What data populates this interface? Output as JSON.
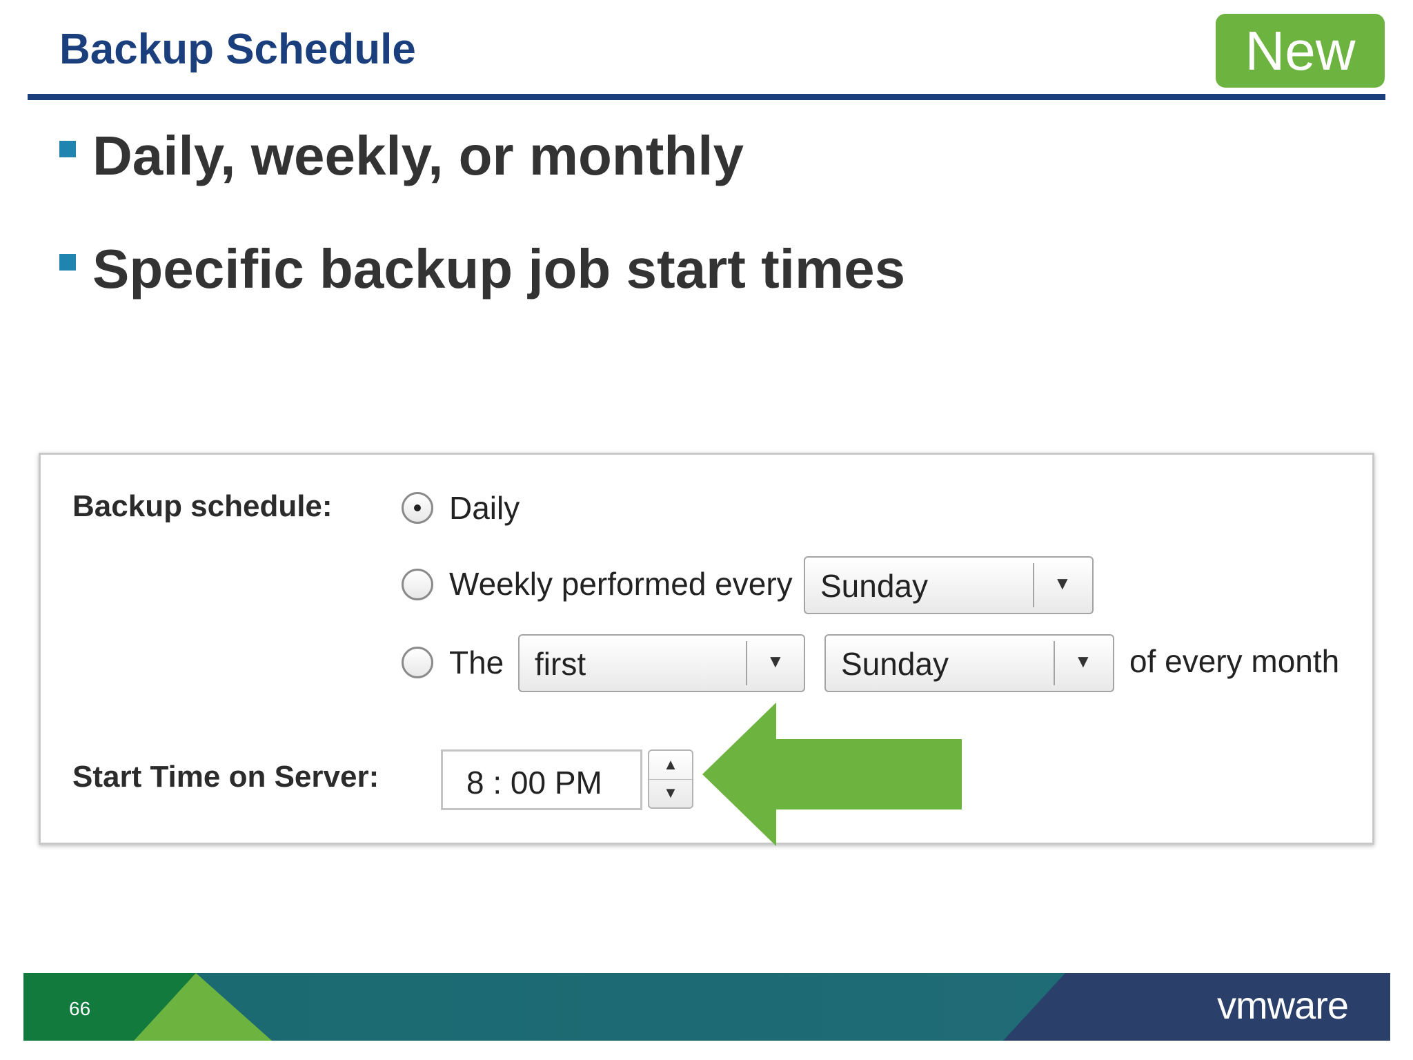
{
  "slide": {
    "title": "Backup Schedule",
    "badge": "New",
    "bullets": [
      "Daily, weekly, or monthly",
      "Specific backup job start times"
    ],
    "page_number": "66",
    "logo_text": "vmware"
  },
  "form": {
    "schedule_label": "Backup schedule:",
    "options": {
      "daily": "Daily",
      "weekly": "Weekly performed every",
      "monthly_prefix": "The",
      "monthly_suffix": "of every month"
    },
    "selected_option": "daily",
    "weekly_day": "Sunday",
    "monthly_ordinal": "first",
    "monthly_day": "Sunday",
    "start_time_label": "Start Time on Server:",
    "start_time_value": "8 : 00 PM"
  },
  "colors": {
    "title_blue": "#1b3f7c",
    "badge_green": "#6db33f",
    "arrow_green": "#6db33f",
    "bullet_marker": "#1f84b0"
  },
  "icons": {
    "dropdown": "chevron-down-icon",
    "stepper_up": "triangle-up-icon",
    "stepper_down": "triangle-down-icon",
    "pointer": "left-arrow-icon"
  }
}
